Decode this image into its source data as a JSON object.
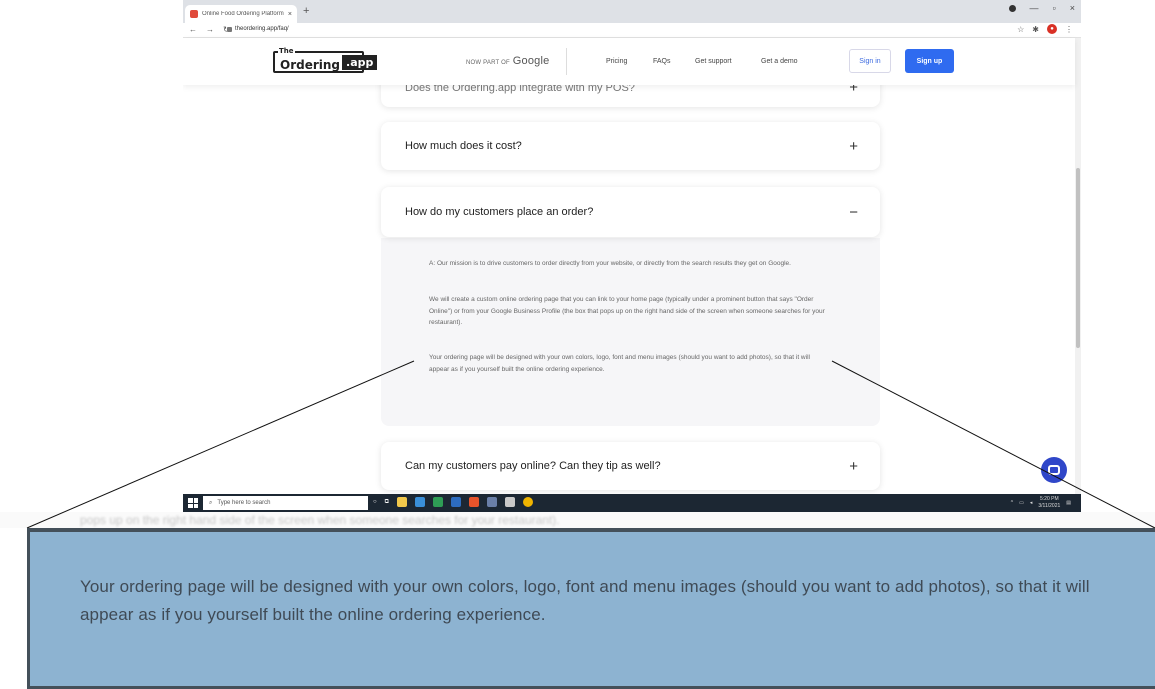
{
  "browser": {
    "tab_title": "Online Food Ordering Platform",
    "tab_close": "×",
    "new_tab": "+",
    "url": "theordering.app/faq/",
    "window_controls": [
      "—",
      "▫",
      "×"
    ]
  },
  "header": {
    "logo_the": "The",
    "logo_word": "Ordering",
    "logo_app": ".app",
    "google_prefix": "NOW PART OF",
    "google_word": "Google",
    "menu": [
      "Pricing",
      "FAQs",
      "Get support",
      "Get a demo"
    ],
    "sign_in": "Sign in",
    "sign_up": "Sign up",
    "colors": {
      "primary": "#2f6bf0",
      "signin_text": "#3d6be0"
    }
  },
  "faq": {
    "partial_question": "Does the Ordering.app integrate with my POS?",
    "items": [
      {
        "question": "How much does it cost?",
        "sign": "+"
      },
      {
        "question": "How do my customers place an order?",
        "sign": "−"
      },
      {
        "question": "Can my customers pay online? Can they tip as well?",
        "sign": "+"
      }
    ],
    "answer": [
      "A: Our mission is to drive customers to order directly from your website, or directly from the search results they get on Google.",
      "We will create a custom online ordering page that you can link to your home page (typically under a prominent button that says \"Order Online\") or from your Google Business Profile (the box that pops up on the right hand side of the screen when someone searches for your restaurant).",
      "Your ordering page will be designed with your own colors, logo, font and menu images (should you want to add photos), so that it will appear as if you yourself built the online ordering experience."
    ]
  },
  "taskbar": {
    "search_placeholder": "Type here to search",
    "time": "5:20 PM",
    "date": "3/11/2021"
  },
  "callout": {
    "text": "Your ordering page will be designed with your own colors, logo, font and menu images (should you want to add photos), so that it will appear as if you yourself built the online ordering experience.",
    "color": "#8db3d1"
  }
}
